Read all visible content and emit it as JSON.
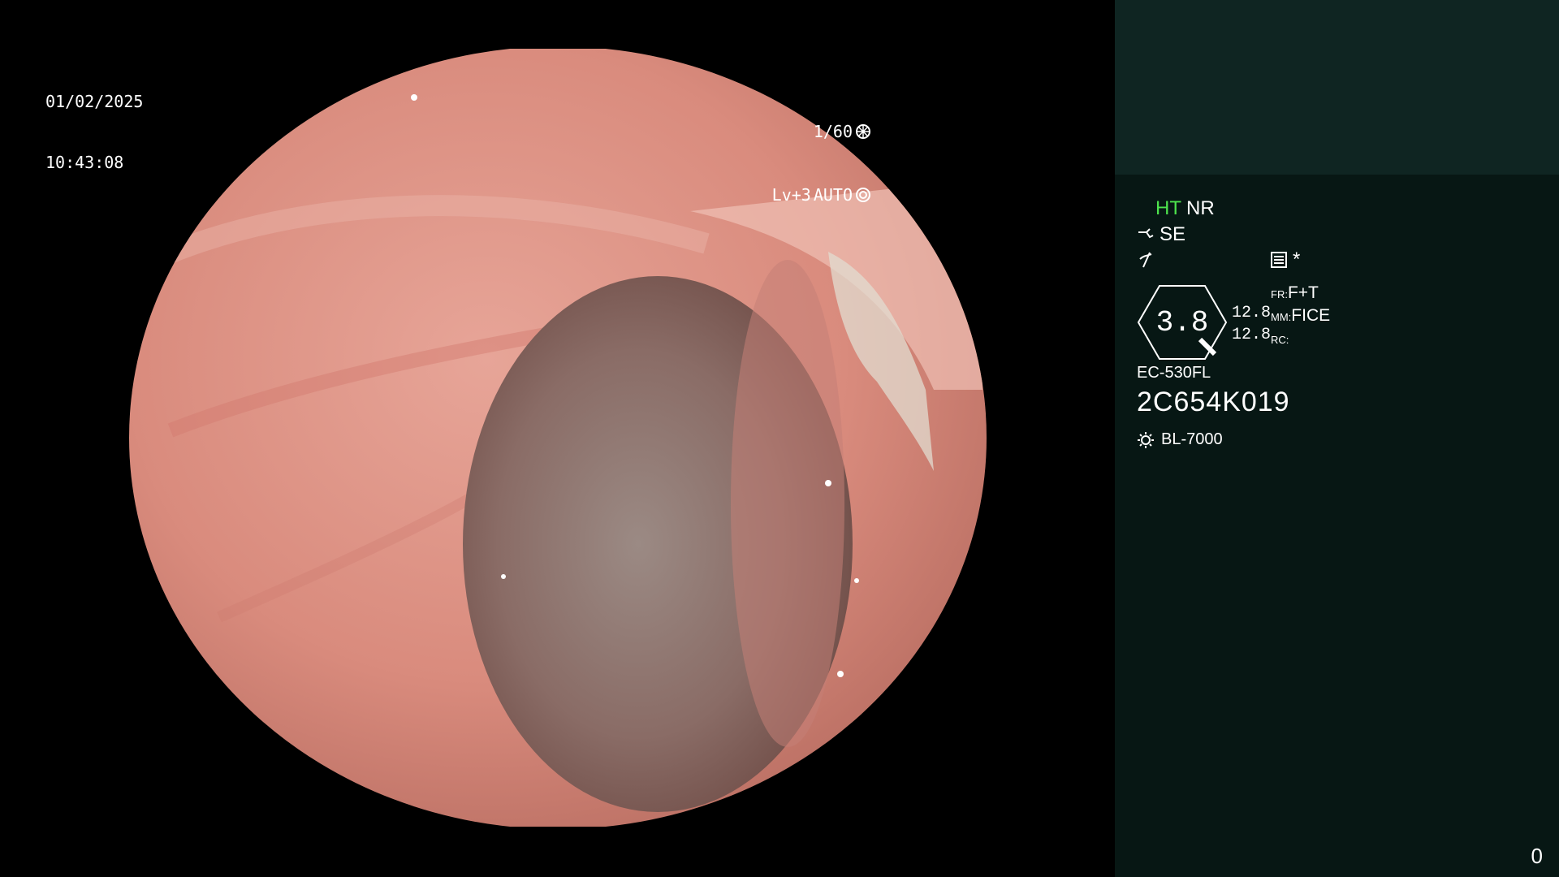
{
  "overlay": {
    "date": "01/02/2025",
    "time": "10:43:08",
    "shutter": "1/60",
    "level": "Lv+3",
    "mode": "AUTO"
  },
  "panel": {
    "ht": "HT",
    "nr": "NR",
    "se": "SE",
    "star": "*",
    "gauge_value": "3.8",
    "num1": "12.8",
    "num2": "12.8",
    "fr_key": "FR:",
    "fr_val": "F+T",
    "mm_key": "MM:",
    "mm_val": "FICE",
    "rc_key": "RC:",
    "rc_val": "",
    "scope_model": "EC-530FL",
    "scope_serial": "2C654K019",
    "light_source": "BL-7000",
    "counter": "0"
  },
  "colors": {
    "panel_bg": "#071714",
    "panel_top_bg": "#0f2522",
    "ht_green": "#4de34d"
  },
  "icons": [
    "aperture-icon",
    "iris-icon",
    "scope-icon",
    "lightning-icon",
    "memory-icon",
    "gauge-icon",
    "lamp-icon"
  ]
}
